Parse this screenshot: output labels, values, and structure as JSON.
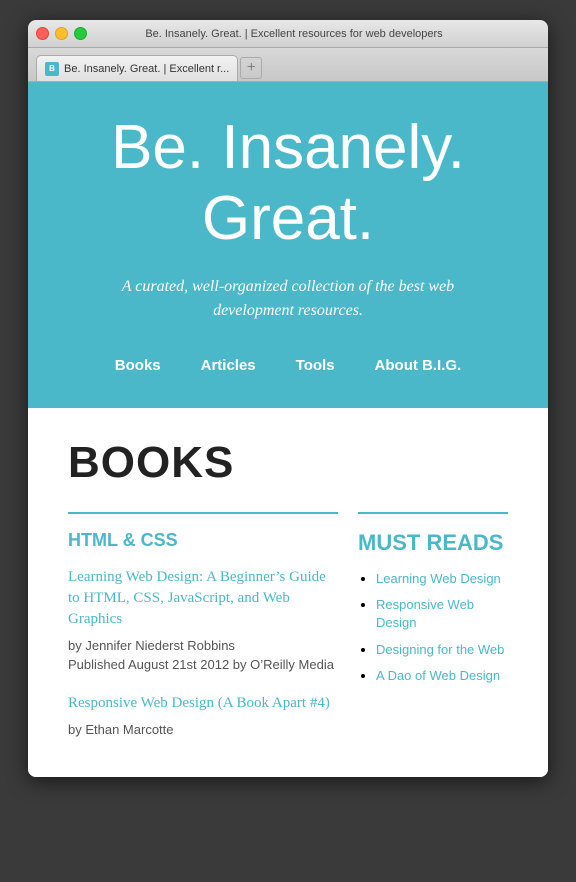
{
  "window": {
    "titlebar_text": "Be. Insanely. Great. | Excellent resources for web developers",
    "tab_label": "Be. Insanely. Great. | Excellent r...",
    "tab_favicon_letter": "B",
    "tab_add_label": "+"
  },
  "hero": {
    "title_line1": "Be. Insanely.",
    "title_line2": "Great.",
    "subtitle": "A curated, well-organized collection of the best web development resources."
  },
  "nav": {
    "items": [
      "Books",
      "Articles",
      "Tools",
      "About B.I.G."
    ]
  },
  "main": {
    "section_heading": "BOOKS",
    "html_css_section": {
      "heading": "HTML & CSS",
      "books": [
        {
          "title": "Learning Web Design: A Beginner’s Guide to HTML, CSS, JavaScript, and Web Graphics",
          "author": "by Jennifer Niederst Robbins",
          "published": "Published August 21st 2012 by O’Reilly Media"
        },
        {
          "title": "Responsive Web Design (A Book Apart #4)",
          "author": "by Ethan Marcotte",
          "published": ""
        }
      ]
    },
    "must_reads": {
      "heading": "MUST READS",
      "items": [
        "Learning Web Design",
        "Responsive Web Design",
        "Designing for the Web",
        "A Dao of Web Design"
      ]
    }
  }
}
